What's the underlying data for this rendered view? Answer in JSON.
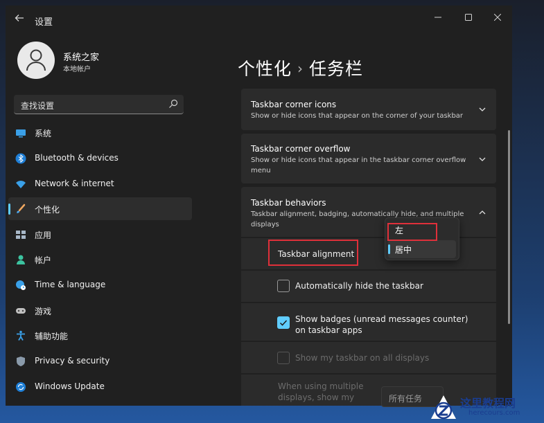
{
  "window": {
    "title": "设置",
    "back_icon": "back-arrow-icon"
  },
  "profile": {
    "name": "系统之家",
    "account_type": "本地帐户"
  },
  "search": {
    "placeholder": "查找设置"
  },
  "sidebar": {
    "items": [
      {
        "label": "系统",
        "icon": "monitor-icon"
      },
      {
        "label": "Bluetooth & devices",
        "icon": "bluetooth-icon"
      },
      {
        "label": "Network & internet",
        "icon": "wifi-icon"
      },
      {
        "label": "个性化",
        "icon": "brush-icon",
        "selected": true
      },
      {
        "label": "应用",
        "icon": "apps-icon"
      },
      {
        "label": "帐户",
        "icon": "person-icon"
      },
      {
        "label": "Time & language",
        "icon": "globe-clock-icon"
      },
      {
        "label": "游戏",
        "icon": "gamepad-icon"
      },
      {
        "label": "辅助功能",
        "icon": "accessibility-icon"
      },
      {
        "label": "Privacy & security",
        "icon": "shield-icon"
      },
      {
        "label": "Windows Update",
        "icon": "update-icon"
      }
    ]
  },
  "main": {
    "breadcrumb": {
      "parent": "个性化",
      "separator": "›",
      "current": "任务栏"
    },
    "cards": {
      "corner_icons": {
        "title": "Taskbar corner icons",
        "desc": "Show or hide icons that appear on the corner of your taskbar"
      },
      "corner_overflow": {
        "title": "Taskbar corner overflow",
        "desc": "Show or hide icons that appear in the taskbar corner overflow menu"
      },
      "behaviors": {
        "title": "Taskbar behaviors",
        "desc": "Taskbar alignment, badging, automatically hide, and multiple displays"
      }
    },
    "behaviors": {
      "alignment_label": "Taskbar alignment",
      "alignment_options": [
        "左",
        "居中"
      ],
      "alignment_selected": "居中",
      "auto_hide": {
        "label": "Automatically hide the taskbar",
        "checked": false
      },
      "badges": {
        "label": "Show badges (unread messages counter) on taskbar apps",
        "checked": true
      },
      "all_displays": {
        "label": "Show my taskbar on all displays",
        "checked": false,
        "disabled": true
      },
      "multiple_displays": {
        "label": "When using multiple displays, show my",
        "combo_value": "所有任务"
      }
    }
  },
  "watermark": {
    "title": "这里教程网",
    "url": "herecours.com"
  },
  "colors": {
    "accent": "#60cdff",
    "window_bg": "#202020",
    "card_bg": "#2b2b2b",
    "highlight": "#e0303a"
  }
}
